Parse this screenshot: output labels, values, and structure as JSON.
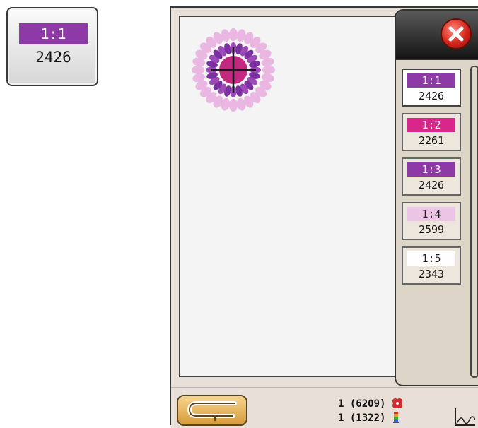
{
  "zoom_detail": {
    "label": "1:1",
    "count": "2426",
    "color": "#8e3aa6"
  },
  "thread_list": [
    {
      "label": "1:1",
      "count": "2426",
      "color": "#8e3aa6",
      "text_color": "#ffffff",
      "selected": true
    },
    {
      "label": "1:2",
      "count": "2261",
      "color": "#d9268a",
      "text_color": "#ffffff",
      "selected": false
    },
    {
      "label": "1:3",
      "count": "2426",
      "color": "#8e3aa6",
      "text_color": "#ffffff",
      "selected": false
    },
    {
      "label": "1:4",
      "count": "2599",
      "color": "#ecc5e6",
      "text_color": "#222222",
      "selected": false
    },
    {
      "label": "1:5",
      "count": "2343",
      "color": "#ffffff",
      "text_color": "#222222",
      "selected": false
    }
  ],
  "status": {
    "designs_line": "1 (6209)",
    "colors_line": "1 (1322)"
  },
  "icons": {
    "close": "close-icon",
    "back": "back-arrow-icon",
    "design": "flower-design-icon",
    "spool": "thread-spool-icon",
    "stitch": "stitch-graph-icon"
  }
}
